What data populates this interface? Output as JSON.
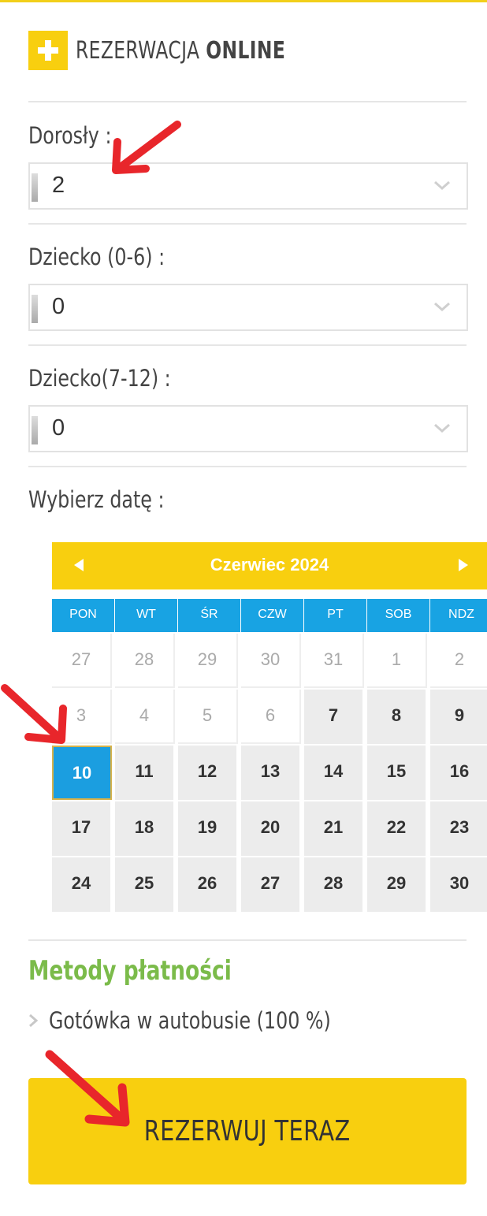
{
  "header": {
    "title_prefix": "REZERWACJA",
    "title_bold": "ONLINE",
    "icon": "plus-icon"
  },
  "fields": {
    "adults": {
      "label": "Dorosły :",
      "value": "2"
    },
    "child_0_6": {
      "label": "Dziecko (0-6) :",
      "value": "0"
    },
    "child_7_12": {
      "label": "Dziecko(7-12) :",
      "value": "0"
    }
  },
  "date_label": "Wybierz datę :",
  "calendar": {
    "month_title": "Czerwiec 2024",
    "weekdays": [
      "PON",
      "WT",
      "ŚR",
      "CZW",
      "PT",
      "SOB",
      "NDZ"
    ],
    "weeks": [
      [
        {
          "d": "27",
          "s": "dis"
        },
        {
          "d": "28",
          "s": "dis"
        },
        {
          "d": "29",
          "s": "dis"
        },
        {
          "d": "30",
          "s": "dis"
        },
        {
          "d": "31",
          "s": "dis"
        },
        {
          "d": "1",
          "s": "dis"
        },
        {
          "d": "2",
          "s": "dis"
        }
      ],
      [
        {
          "d": "3",
          "s": "dis"
        },
        {
          "d": "4",
          "s": "dis"
        },
        {
          "d": "5",
          "s": "dis"
        },
        {
          "d": "6",
          "s": "dis"
        },
        {
          "d": "7",
          "s": "act"
        },
        {
          "d": "8",
          "s": "act"
        },
        {
          "d": "9",
          "s": "act"
        }
      ],
      [
        {
          "d": "10",
          "s": "sel"
        },
        {
          "d": "11",
          "s": "act"
        },
        {
          "d": "12",
          "s": "act"
        },
        {
          "d": "13",
          "s": "act"
        },
        {
          "d": "14",
          "s": "act"
        },
        {
          "d": "15",
          "s": "act"
        },
        {
          "d": "16",
          "s": "act"
        }
      ],
      [
        {
          "d": "17",
          "s": "act"
        },
        {
          "d": "18",
          "s": "act"
        },
        {
          "d": "19",
          "s": "act"
        },
        {
          "d": "20",
          "s": "act"
        },
        {
          "d": "21",
          "s": "act"
        },
        {
          "d": "22",
          "s": "act"
        },
        {
          "d": "23",
          "s": "act"
        }
      ],
      [
        {
          "d": "24",
          "s": "act"
        },
        {
          "d": "25",
          "s": "act"
        },
        {
          "d": "26",
          "s": "act"
        },
        {
          "d": "27",
          "s": "act"
        },
        {
          "d": "28",
          "s": "act"
        },
        {
          "d": "29",
          "s": "act"
        },
        {
          "d": "30",
          "s": "act"
        }
      ]
    ],
    "selected_day": "10"
  },
  "payment": {
    "title": "Metody płatności",
    "option": "Gotówka w autobusie (100 %)"
  },
  "submit_label": "REZERWUJ TERAZ",
  "colors": {
    "accent_yellow": "#f8cf0f",
    "accent_blue": "#18a3e3",
    "payment_green": "#7bbb4a",
    "annotation_red": "#e8262b"
  }
}
